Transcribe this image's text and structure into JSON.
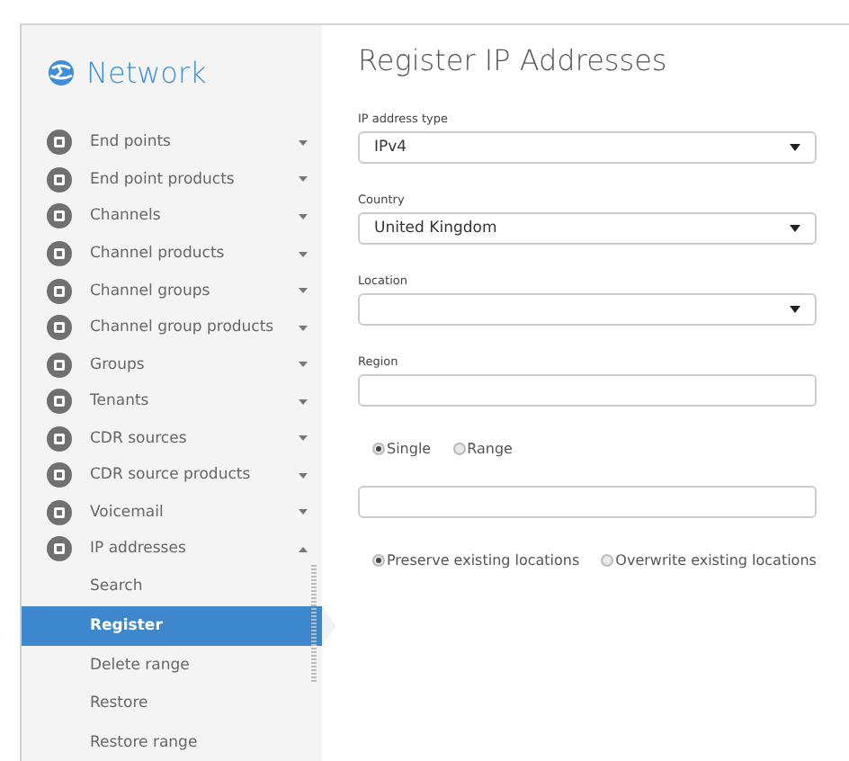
{
  "sidebar": {
    "title": "Network",
    "items": [
      {
        "label": "End points",
        "expanded": false
      },
      {
        "label": "End point products",
        "expanded": false
      },
      {
        "label": "Channels",
        "expanded": false
      },
      {
        "label": "Channel products",
        "expanded": false
      },
      {
        "label": "Channel groups",
        "expanded": false
      },
      {
        "label": "Channel group products",
        "expanded": false
      },
      {
        "label": "Groups",
        "expanded": false
      },
      {
        "label": "Tenants",
        "expanded": false
      },
      {
        "label": "CDR sources",
        "expanded": false
      },
      {
        "label": "CDR source products",
        "expanded": false
      },
      {
        "label": "Voicemail",
        "expanded": false
      },
      {
        "label": "IP addresses",
        "expanded": true,
        "children": [
          {
            "label": "Search",
            "selected": false
          },
          {
            "label": "Register",
            "selected": true
          },
          {
            "label": "Delete range",
            "selected": false
          },
          {
            "label": "Restore",
            "selected": false
          },
          {
            "label": "Restore range",
            "selected": false
          }
        ]
      }
    ]
  },
  "form": {
    "title": "Register IP Addresses",
    "fields": [
      {
        "kind": "select",
        "label": "IP address type",
        "value": "IPv4"
      },
      {
        "kind": "select",
        "label": "Country",
        "value": "United Kingdom"
      },
      {
        "kind": "select",
        "label": "Location"
      },
      {
        "kind": "text",
        "label": "Region"
      },
      {
        "kind": "radios",
        "options": [
          {
            "label": "Single",
            "selected": true
          },
          {
            "label": "Range",
            "selected": false
          }
        ]
      },
      {
        "kind": "text"
      },
      {
        "kind": "radios",
        "options": [
          {
            "label": "Preserve existing locations",
            "selected": true
          },
          {
            "label": "Overwrite existing locations",
            "selected": false
          }
        ]
      }
    ]
  }
}
